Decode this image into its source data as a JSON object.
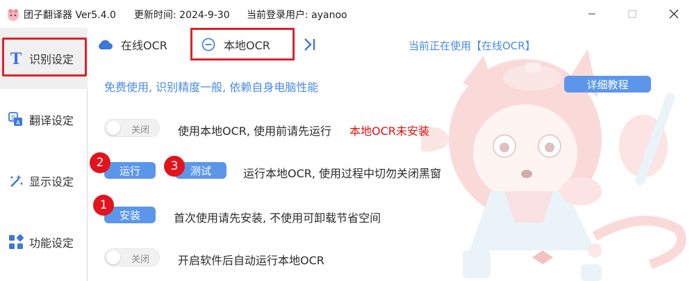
{
  "titlebar": {
    "app_name_version": "团子翻译器 Ver5.4.0",
    "update_time": "更新时间: 2024-9-30",
    "current_user": "当前登录用户: ayanoo",
    "logo_icon": "app-logo-icon",
    "minimize_icon": "minimize-icon",
    "maximize_icon": "maximize-icon",
    "close_icon": "close-icon"
  },
  "sidebar": {
    "items": [
      {
        "label": "识别设定",
        "icon": "text-t-icon",
        "active": true
      },
      {
        "label": "翻译设定",
        "icon": "translate-icon",
        "active": false
      },
      {
        "label": "显示设定",
        "icon": "magic-wand-icon",
        "active": false
      },
      {
        "label": "功能设定",
        "icon": "grid-icon",
        "active": false
      }
    ]
  },
  "tabs": [
    {
      "label": "在线OCR",
      "icon": "cloud-icon"
    },
    {
      "label": "本地OCR",
      "icon": "minus-circle-icon",
      "selected": true
    }
  ],
  "collapse_icon": "chevron-right-bar-icon",
  "status": "当前正在使用【在线OCR】",
  "description": "免费使用, 识别精度一般, 依赖自身电脑性能",
  "tutorial_button": "详细教程",
  "local_ocr_toggle": {
    "label": "关闭",
    "on": false
  },
  "local_ocr_text": "使用本地OCR, 使用前请先运行",
  "not_installed": "本地OCR未安装",
  "run_button": "运行",
  "test_button": "测试",
  "run_note": "运行本地OCR, 使用过程中切勿关闭黑窗",
  "install_button": "安装",
  "install_note": "首次使用请先安装, 不使用可卸载节省空间",
  "auto_run_toggle": {
    "label": "关闭",
    "on": false
  },
  "auto_run_text": "开启软件后自动运行本地OCR",
  "badges": [
    "1",
    "2",
    "3"
  ],
  "colors": {
    "accent": "#5b96ea",
    "link": "#4a8ae8",
    "warning": "#e01010",
    "annotation_red": "#e0202a"
  }
}
